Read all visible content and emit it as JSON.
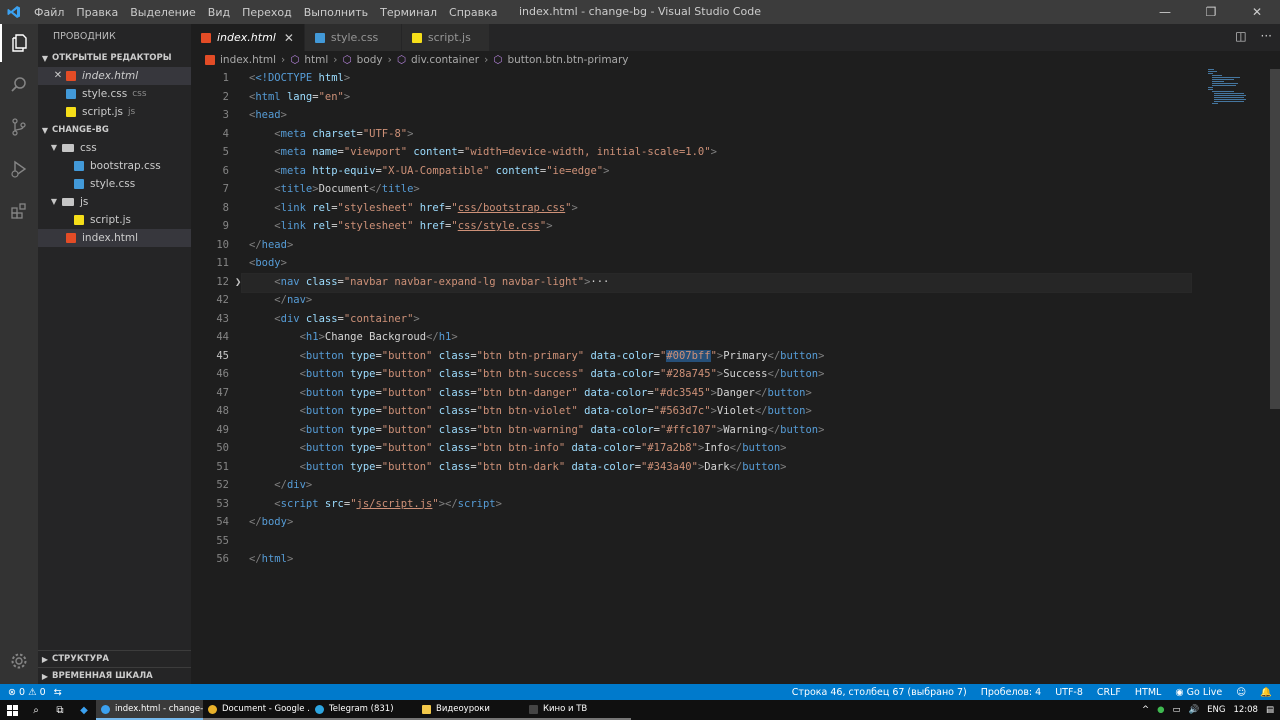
{
  "menu": [
    "Файл",
    "Правка",
    "Выделение",
    "Вид",
    "Переход",
    "Выполнить",
    "Терминал",
    "Справка"
  ],
  "window_title": "index.html - change-bg - Visual Studio Code",
  "sidebar": {
    "title": "ПРОВОДНИК",
    "open_editors_label": "ОТКРЫТЫЕ РЕДАКТОРЫ",
    "open_editors": [
      {
        "name": "index.html",
        "desc": ""
      },
      {
        "name": "style.css",
        "desc": "css"
      },
      {
        "name": "script.js",
        "desc": "js"
      }
    ],
    "project_label": "CHANGE-BG",
    "folder_css": "css",
    "file_bootstrap": "bootstrap.css",
    "file_style": "style.css",
    "folder_js": "js",
    "file_script": "script.js",
    "file_index": "index.html",
    "outline_label": "СТРУКТУРА",
    "timeline_label": "ВРЕМЕННАЯ ШКАЛА"
  },
  "tabs": [
    "index.html",
    "style.css",
    "script.js"
  ],
  "breadcrumb": [
    "index.html",
    "html",
    "body",
    "div.container",
    "button.btn.btn-primary"
  ],
  "code": {
    "line_numbers": [
      "1",
      "2",
      "3",
      "4",
      "5",
      "6",
      "7",
      "8",
      "9",
      "10",
      "11",
      "12",
      "42",
      "43",
      "44",
      "45",
      "46",
      "47",
      "48",
      "49",
      "50",
      "51",
      "52",
      "53",
      "54",
      "55",
      "56",
      "57"
    ],
    "l1_doctype": "<!DOCTYPE",
    "l1_html": " html",
    "l1_end": ">",
    "l46_color": "#007bff",
    "l47_color": "#28a745",
    "l48_color": "#dc3545",
    "l49_color": "#563d7c",
    "l50_color": "#ffc107",
    "l51_color": "#17a2b8",
    "l52_color": "#343a40",
    "h1_text": "Change Backgroud",
    "labels": [
      "Primary",
      "Success",
      "Danger",
      "Violet",
      "Warning",
      "Info",
      "Dark"
    ],
    "title_text": "Document",
    "viewport": "\"width=device-width, initial-scale=1.0\"",
    "nav_class": "\"navbar navbar-expand-lg navbar-light\""
  },
  "status": {
    "errors": "0",
    "warnings": "0",
    "position": "Строка 46, столбец 67 (выбрано 7)",
    "spaces": "Пробелов: 4",
    "encoding": "UTF-8",
    "eol": "CRLF",
    "language": "HTML",
    "golive": "Go Live"
  },
  "taskbar": {
    "apps": [
      "index.html - change-...",
      "Document - Google ...",
      "Telegram (831)",
      "Видеоуроки",
      "Кино и ТВ"
    ],
    "lang": "ENG",
    "time": "12:08"
  },
  "colors": {
    "accent": "#007acc",
    "activity": "#333333",
    "sidebar": "#252526",
    "editor": "#1e1e1e"
  }
}
